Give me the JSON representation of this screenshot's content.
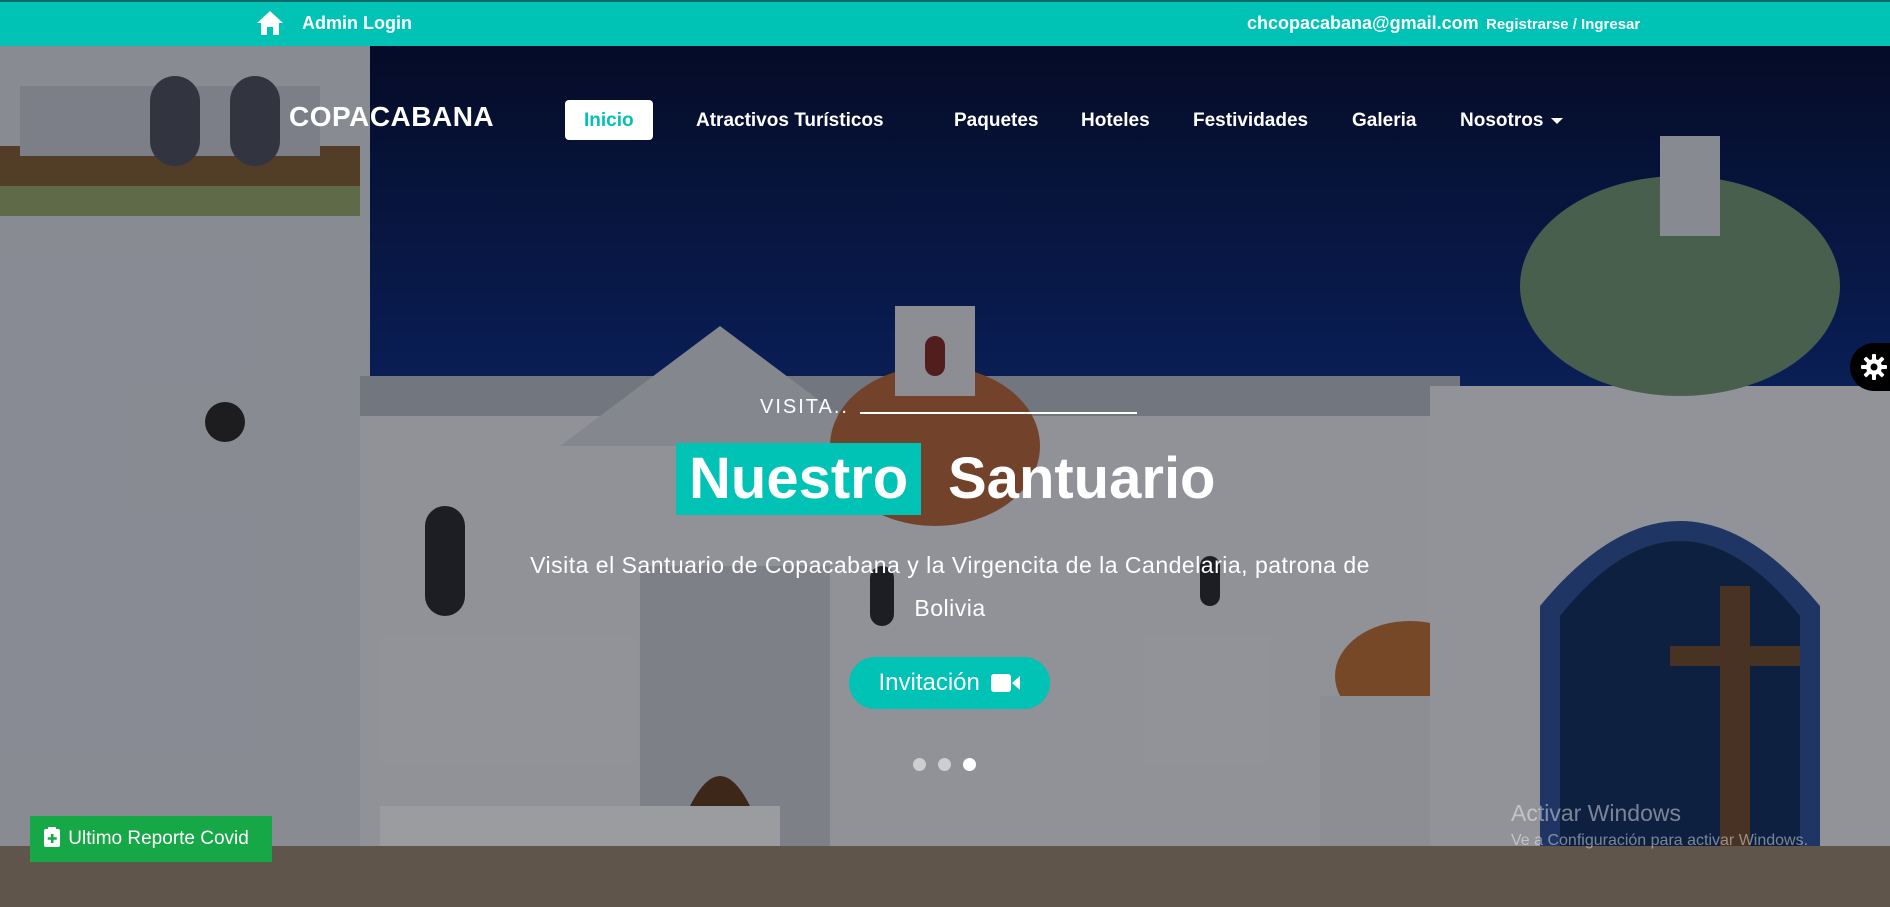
{
  "topbar": {
    "home_icon": "home-icon",
    "admin_label": "Admin Login",
    "email": "chcopacabana@gmail.com",
    "register_label": "Registrarse / Ingresar"
  },
  "navbar": {
    "brand": "COPACABANA",
    "items": [
      {
        "label": "Inicio",
        "active": true
      },
      {
        "label": "Atractivos Turísticos"
      },
      {
        "label": "Paquetes"
      },
      {
        "label": "Hoteles"
      },
      {
        "label": "Festividades"
      },
      {
        "label": "Galeria"
      },
      {
        "label": "Nosotros",
        "dropdown": true
      }
    ]
  },
  "hero": {
    "kicker": "VISITA..",
    "title_highlight": "Nuestro",
    "title_rest": "Santuario",
    "subtitle_line1": "Visita el Santuario de Copacabana y la Virgencita de la Candelaria, patrona de",
    "subtitle_line2": "Bolivia",
    "cta_label": "Invitación",
    "cta_icon": "video-camera-icon",
    "slide_count": 3,
    "active_slide": 3
  },
  "widgets": {
    "settings_icon": "gear-icon",
    "covid_label": "Ultimo Reporte Covid",
    "covid_icon": "clipboard-plus-icon"
  },
  "watermark": {
    "line1": "Activar Windows",
    "line2": "Ve a Configuración para activar Windows."
  },
  "colors": {
    "accent": "#00c2b5",
    "covid_button": "#16a847",
    "text": "#ffffff"
  }
}
